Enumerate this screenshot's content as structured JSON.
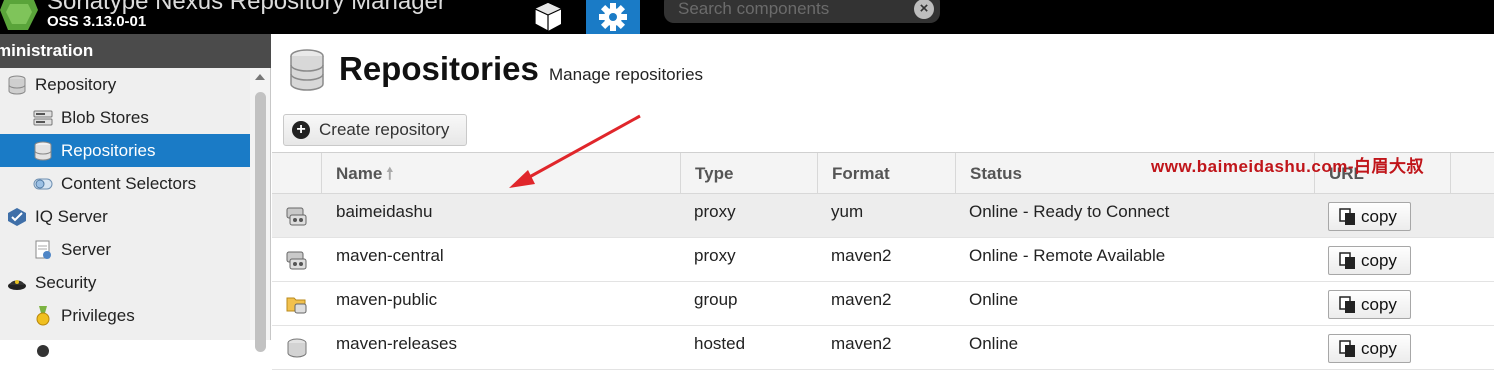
{
  "header": {
    "app_title": "Sonatype Nexus Repository Manager",
    "version": "OSS 3.13.0-01",
    "search_placeholder": "Search components",
    "search_clear": "×",
    "colors": {
      "admin_active": "#1a7bc6",
      "background": "#000000"
    }
  },
  "sidebar": {
    "title": "ministration",
    "items": [
      {
        "label": "Repository",
        "icon": "database-icon"
      },
      {
        "label": "Blob Stores",
        "icon": "server-icon"
      },
      {
        "label": "Repositories",
        "icon": "database-icon",
        "selected": true
      },
      {
        "label": "Content Selectors",
        "icon": "selector-icon"
      },
      {
        "label": "IQ Server",
        "icon": "iq-server-icon"
      },
      {
        "label": "Server",
        "icon": "document-icon"
      },
      {
        "label": "Security",
        "icon": "police-hat-icon"
      },
      {
        "label": "Privileges",
        "icon": "medal-icon"
      }
    ]
  },
  "main": {
    "title": "Repositories",
    "subtitle": "Manage repositories",
    "create_button": "Create repository",
    "create_icon": "+",
    "columns": [
      "Name",
      "Type",
      "Format",
      "Status",
      "URL"
    ],
    "sort_indicator": "🠕",
    "copy_label": "copy",
    "rows": [
      {
        "name": "baimeidashu",
        "type": "proxy",
        "format": "yum",
        "status": "Online - Ready to Connect",
        "icon": "proxy-icon"
      },
      {
        "name": "maven-central",
        "type": "proxy",
        "format": "maven2",
        "status": "Online - Remote Available",
        "icon": "proxy-icon"
      },
      {
        "name": "maven-public",
        "type": "group",
        "format": "maven2",
        "status": "Online",
        "icon": "group-folder-icon"
      },
      {
        "name": "maven-releases",
        "type": "hosted",
        "format": "maven2",
        "status": "Online",
        "icon": "hosted-icon"
      }
    ]
  },
  "watermark": "www.baimeidashu.com-白眉大叔",
  "annotation_color": "#e0262b"
}
